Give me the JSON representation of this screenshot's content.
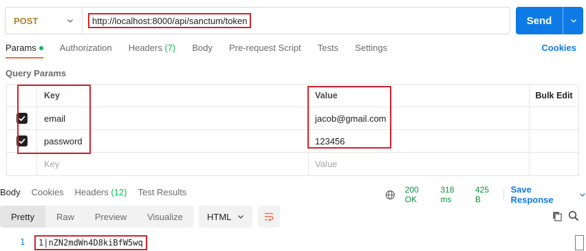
{
  "request": {
    "method": "POST",
    "url": "http://localhost:8000/api/sanctum/token",
    "send_label": "Send"
  },
  "tabs": [
    {
      "label": "Params",
      "active": true
    },
    {
      "label": "Authorization"
    },
    {
      "label": "Headers",
      "count": "(7)"
    },
    {
      "label": "Body"
    },
    {
      "label": "Pre-request Script"
    },
    {
      "label": "Tests"
    },
    {
      "label": "Settings"
    }
  ],
  "cookies_label": "Cookies",
  "query_params": {
    "title": "Query Params",
    "headers": {
      "key": "Key",
      "value": "Value",
      "bulk_edit": "Bulk Edit"
    },
    "rows": [
      {
        "checked": true,
        "key": "email",
        "value": "jacob@gmail.com"
      },
      {
        "checked": true,
        "key": "password",
        "value": "123456"
      }
    ],
    "placeholder": {
      "key": "Key",
      "value": "Value"
    }
  },
  "response": {
    "tabs": [
      {
        "label": "Body",
        "active": true
      },
      {
        "label": "Cookies"
      },
      {
        "label": "Headers",
        "count": "(12)"
      },
      {
        "label": "Test Results"
      }
    ],
    "status": "200 OK",
    "time": "318 ms",
    "size": "425 B",
    "save_label": "Save Response",
    "view_modes": [
      "Pretty",
      "Raw",
      "Preview",
      "Visualize"
    ],
    "format": "HTML",
    "line_number": "1",
    "body_line": "1|nZN2mdWn4D8kiBfW5wq"
  },
  "colors": {
    "accent": "#0e7ae6",
    "method": "#a8842a",
    "active_tab": "#f26b3a",
    "success": "#0cbb52",
    "highlight": "#d3202a"
  }
}
